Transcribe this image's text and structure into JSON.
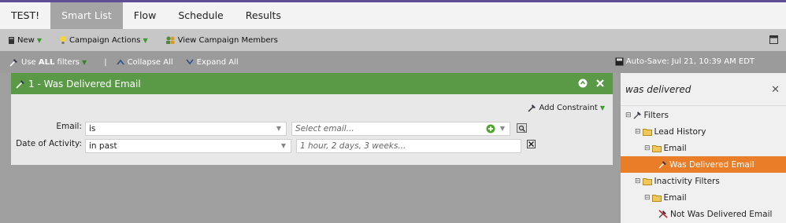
{
  "tabs": [
    "TEST!",
    "Smart List",
    "Flow",
    "Schedule",
    "Results"
  ],
  "toolbar": {
    "new_label": "New",
    "campaign_actions_label": "Campaign Actions",
    "view_members_label": "View Campaign Members"
  },
  "filterbar": {
    "use_all_prefix": "Use",
    "use_all_bold": "ALL",
    "use_all_suffix": "filters",
    "separator": "|",
    "collapse_label": "Collapse All",
    "expand_label": "Expand All",
    "autosave": "Auto-Save: Jul 21, 10:39 AM EDT"
  },
  "filter_card": {
    "title": "1 - Was Delivered Email",
    "add_constraint": "Add Constraint",
    "email_label": "Email:",
    "email_operator": "is",
    "email_placeholder": "Select email...",
    "date_label": "Date of Activity:",
    "date_operator": "in past",
    "date_placeholder": "1 hour, 2 days, 3 weeks..."
  },
  "right_panel": {
    "search_value": "was delivered",
    "tree": {
      "filters": "Filters",
      "lead_history": "Lead History",
      "email_1": "Email",
      "was_delivered": "Was Delivered Email",
      "inactivity": "Inactivity Filters",
      "email_2": "Email",
      "not_was_delivered": "Not Was Delivered Email"
    }
  },
  "colors": {
    "active_tab": "#a5a5a5",
    "card_header": "#5a9a47",
    "highlight": "#ea7d27",
    "top_line": "#5c4f96"
  }
}
